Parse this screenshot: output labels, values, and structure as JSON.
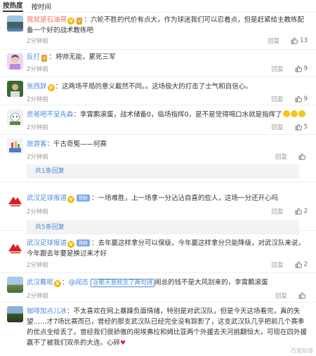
{
  "tabs": [
    "按热度",
    "按时间"
  ],
  "actions": {
    "reply": "回复"
  },
  "comments": [
    {
      "user": "我就是石油哥",
      "text": "：六轮不胜的代价有点大，作为球迷我们可以忍着点，但是赶紧给主教练配备一个好的战术教练吧",
      "time": "2分钟前",
      "likes": "13"
    },
    {
      "user": "反打",
      "text": "：将帅无能，累死三军",
      "time": "2分钟前",
      "likes": "9"
    },
    {
      "user": "张西辞",
      "text": "：这两场平局的意义截然不同。。这场极大的打击了士气和自信心。",
      "time": "2分钟前",
      "likes": "9"
    },
    {
      "user": "贡爸吧不呈先森",
      "text": "：李霄鹏滚蛋，战术储备0，临场指挥0，是不是觉得喝口水就是指挥了",
      "time": "2分钟前",
      "likes": "5"
    },
    {
      "user": "旅游客",
      "text": "：千古奇冤——何赛",
      "time": "2分钟前",
      "likes": ""
    },
    {
      "user": "武汉足球报道",
      "badge": "铁粉",
      "text": "：一场难胜，上一场拿一分沾沾自喜的些人，这场一分还开心吗",
      "time": "2分钟前",
      "likes": "2"
    },
    {
      "user": "武汉足球报道",
      "badge": "铁粉",
      "text": "：去年赢这样拿分可以保级，今年赢这样拿分只能降级，对武汉队来说，今年跟去年要是换过来才好",
      "time": "2分钟前",
      "likes": "2"
    },
    {
      "user": "武汉戴呢",
      "mention": "@阎志",
      "link": "@那天我就念了两句诗",
      "text": "闹总的钱不是大风刮来的，李霄鹏滚蛋",
      "time": "2分钟前",
      "likes": ""
    },
    {
      "user": "咖啡加点儿冰",
      "text": "：不太喜欢在网上暴躁负面情绪，特别是对武汉队，但是今天这场看完，真的失望……才7场比赛而已，曾经的那支武汉队已经完全没有踪影了，这支武汉队几乎把前几个赛季的优点全给丢了。曾经我们很骄傲的用埃弗拉和姆比亚两个外援去天河挑翻恒大，可现在四外援赢不了被我们双杀的大连。心碎",
      "time": "",
      "likes": ""
    }
  ],
  "reply_counts": [
    "共1条回复",
    "共5条回复"
  ],
  "watermark": "百度知道"
}
